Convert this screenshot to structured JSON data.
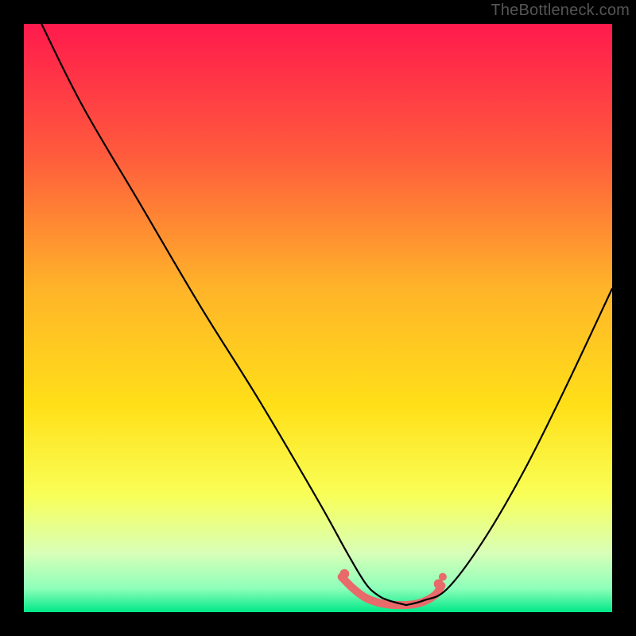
{
  "watermark": "TheBottleneck.com",
  "chart_data": {
    "type": "line",
    "title": "",
    "xlabel": "",
    "ylabel": "",
    "xlim": [
      0,
      100
    ],
    "ylim": [
      0,
      100
    ],
    "grid": false,
    "legend": false,
    "background_gradient": {
      "stops": [
        {
          "offset": 0.0,
          "color": "#ff1a4d"
        },
        {
          "offset": 0.22,
          "color": "#ff5a3d"
        },
        {
          "offset": 0.45,
          "color": "#ffb429"
        },
        {
          "offset": 0.65,
          "color": "#ffe018"
        },
        {
          "offset": 0.8,
          "color": "#f9ff57"
        },
        {
          "offset": 0.9,
          "color": "#d8ffb8"
        },
        {
          "offset": 0.96,
          "color": "#8dffba"
        },
        {
          "offset": 1.0,
          "color": "#00e887"
        }
      ]
    },
    "series": [
      {
        "name": "left-branch",
        "x": [
          3,
          10,
          20,
          30,
          40,
          50,
          55,
          58,
          60,
          62,
          65
        ],
        "y": [
          100,
          86,
          69,
          52,
          36,
          19,
          10,
          5,
          3,
          2,
          1.2
        ],
        "stroke": "#000000",
        "width": 2.2
      },
      {
        "name": "right-branch",
        "x": [
          65,
          68,
          72,
          78,
          85,
          92,
          100
        ],
        "y": [
          1.2,
          2,
          4,
          12,
          24,
          38,
          55
        ],
        "stroke": "#000000",
        "width": 2.2
      },
      {
        "name": "highlight-band",
        "x": [
          54,
          56,
          58,
          60,
          62,
          64,
          66,
          68,
          70,
          71
        ],
        "y": [
          6,
          4,
          2.5,
          1.7,
          1.3,
          1.2,
          1.3,
          1.8,
          3,
          4.5
        ],
        "stroke": "#e86a6a",
        "width": 10
      }
    ],
    "markers": [
      {
        "x": 54.5,
        "y": 6.5,
        "r": 6,
        "color": "#e86a6a"
      },
      {
        "x": 70.5,
        "y": 4.8,
        "r": 6,
        "color": "#e86a6a"
      },
      {
        "x": 71.2,
        "y": 6.0,
        "r": 5,
        "color": "#e86a6a"
      }
    ]
  }
}
